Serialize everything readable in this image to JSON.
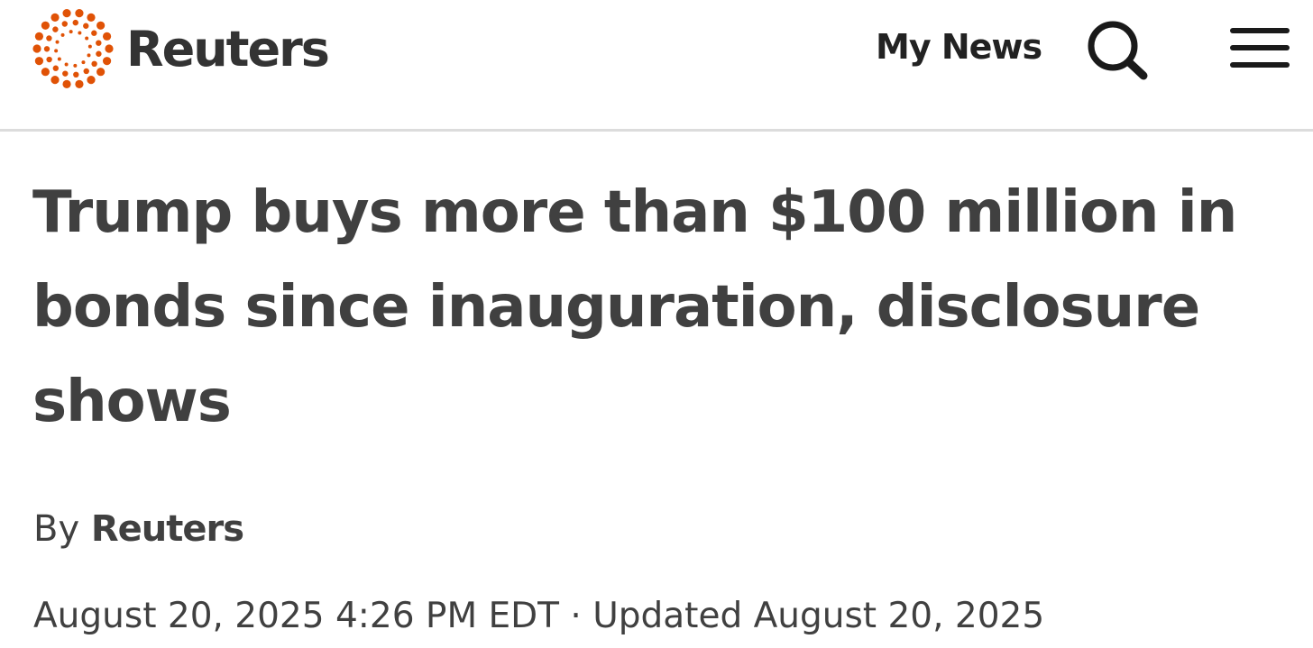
{
  "header": {
    "brand": "Reuters",
    "my_news_label": "My News",
    "search_icon": "search-icon",
    "menu_icon": "hamburger-menu-icon",
    "brand_color": "#e05206"
  },
  "article": {
    "headline": "Trump buys more than $100 million in bonds since inauguration, disclosure shows",
    "by_prefix": "By",
    "author": "Reuters",
    "published": "August 20, 2025 4:26 PM EDT",
    "separator": "·",
    "updated": "Updated August 20, 2025"
  }
}
